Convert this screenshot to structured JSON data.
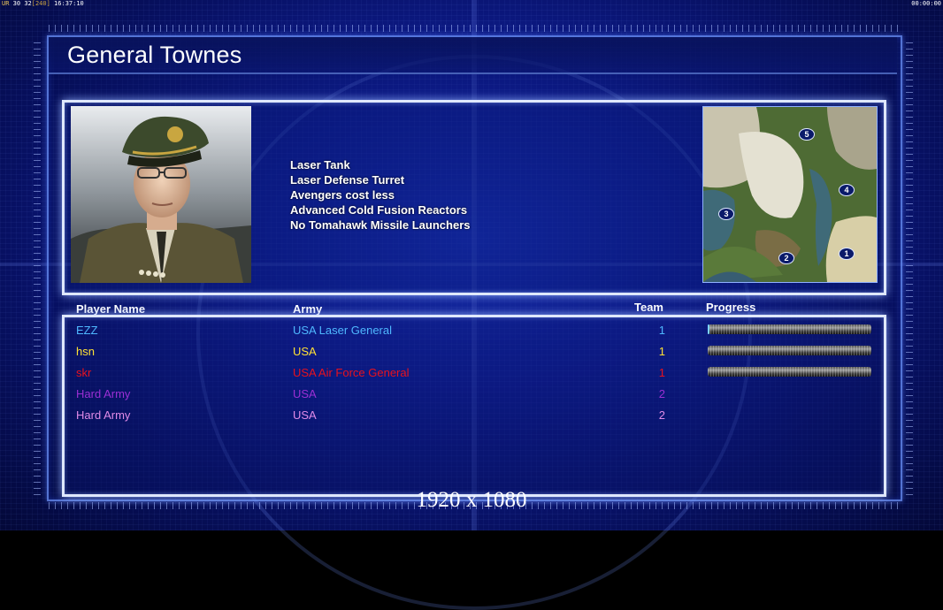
{
  "status_bar": {
    "left": {
      "ur": "UR",
      "a": "30",
      "b": "32",
      "c": "[240]",
      "time": "16:37:10"
    },
    "right": "00:00:00"
  },
  "general": {
    "name": "General Townes",
    "features": [
      "Laser Tank",
      "Laser Defense Turret",
      "Avengers cost less",
      "Advanced Cold Fusion Reactors",
      "No Tomahawk Missile Launchers"
    ]
  },
  "minimap": {
    "slots": [
      "1",
      "2",
      "3",
      "4",
      "5"
    ]
  },
  "players": {
    "headers": {
      "name": "Player Name",
      "army": "Army",
      "team": "Team",
      "progress": "Progress"
    },
    "rows": [
      {
        "name": "EZZ",
        "army": "USA Laser General",
        "team": "1",
        "color": "#4fb8ff",
        "progress": 0.01,
        "show_progress": true
      },
      {
        "name": "hsn",
        "army": "USA",
        "team": "1",
        "color": "#ffe135",
        "progress": 0,
        "show_progress": true
      },
      {
        "name": "skr",
        "army": "USA Air Force General",
        "team": "1",
        "color": "#e8121e",
        "progress": 0,
        "show_progress": true
      },
      {
        "name": "Hard Army",
        "army": "USA",
        "team": "2",
        "color": "#9b2fd4",
        "progress": null,
        "show_progress": false
      },
      {
        "name": "Hard Army",
        "army": "USA",
        "team": "2",
        "color": "#e08be8",
        "progress": null,
        "show_progress": false
      }
    ]
  },
  "resolution_label": "1920 x 1080"
}
